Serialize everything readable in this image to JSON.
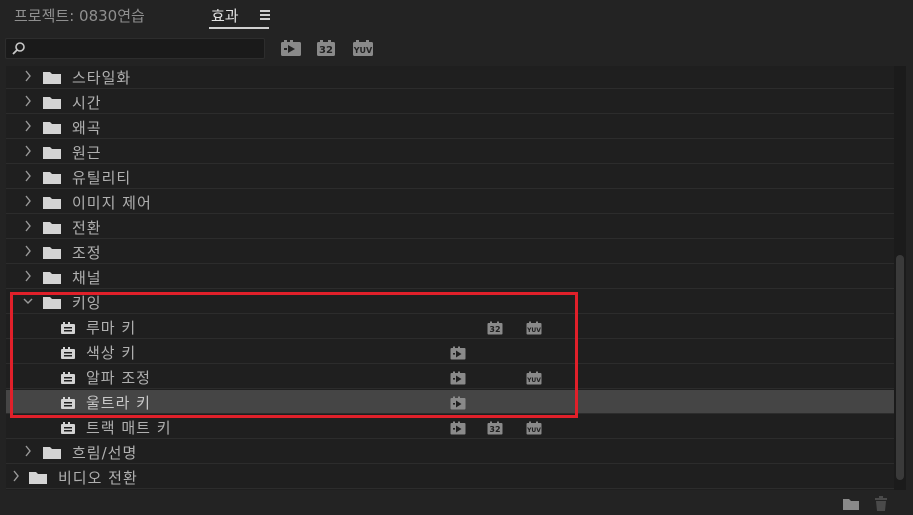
{
  "tabs": {
    "project": "프로젝트: 0830연습",
    "effects": "효과"
  },
  "search": {
    "value": "",
    "placeholder": ""
  },
  "filters": [
    {
      "name": "accelerated-effects",
      "text": ""
    },
    {
      "name": "32bit",
      "text": "32"
    },
    {
      "name": "yuv",
      "text": "YUV"
    }
  ],
  "tree": [
    {
      "label": "스타일화",
      "type": "folder",
      "level": 1,
      "expanded": false
    },
    {
      "label": "시간",
      "type": "folder",
      "level": 1,
      "expanded": false
    },
    {
      "label": "왜곡",
      "type": "folder",
      "level": 1,
      "expanded": false
    },
    {
      "label": "원근",
      "type": "folder",
      "level": 1,
      "expanded": false
    },
    {
      "label": "유틸리티",
      "type": "folder",
      "level": 1,
      "expanded": false
    },
    {
      "label": "이미지 제어",
      "type": "folder",
      "level": 1,
      "expanded": false
    },
    {
      "label": "전환",
      "type": "folder",
      "level": 1,
      "expanded": false
    },
    {
      "label": "조정",
      "type": "folder",
      "level": 1,
      "expanded": false
    },
    {
      "label": "채널",
      "type": "folder",
      "level": 1,
      "expanded": false
    },
    {
      "label": "키잉",
      "type": "folder",
      "level": 1,
      "expanded": true
    },
    {
      "label": "루마 키",
      "type": "effect",
      "level": 2,
      "accel": false,
      "b32": true,
      "yuv": true
    },
    {
      "label": "색상 키",
      "type": "effect",
      "level": 2,
      "accel": true,
      "b32": false,
      "yuv": false
    },
    {
      "label": "알파 조정",
      "type": "effect",
      "level": 2,
      "accel": true,
      "b32": false,
      "yuv": true
    },
    {
      "label": "울트라 키",
      "type": "effect",
      "level": 2,
      "accel": true,
      "b32": false,
      "yuv": false,
      "selected": true
    },
    {
      "label": "트랙 매트 키",
      "type": "effect",
      "level": 2,
      "accel": true,
      "b32": true,
      "yuv": true
    },
    {
      "label": "흐림/선명",
      "type": "folder",
      "level": 1,
      "expanded": false
    },
    {
      "label": "비디오 전환",
      "type": "folder",
      "level": 0,
      "expanded": false
    }
  ],
  "colors": {
    "background": "#232323",
    "tree_background": "#1f1f1f",
    "selected_row": "#454545",
    "highlight_box": "#e0202a"
  },
  "icons": {
    "menu": "hamburger-menu-icon",
    "search": "search-icon",
    "folder": "folder-icon",
    "effect": "effect-icon",
    "new_bin": "new-bin-icon",
    "trash": "trash-icon"
  }
}
